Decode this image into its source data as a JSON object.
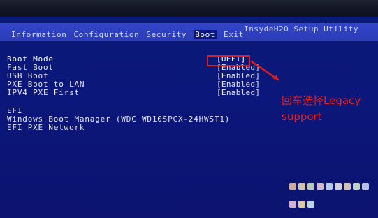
{
  "bios": {
    "utility_title": "InsydeH2O Setup Utility",
    "tabs": [
      {
        "label": "Information"
      },
      {
        "label": "Configuration"
      },
      {
        "label": "Security"
      },
      {
        "label": "Boot",
        "active": true
      },
      {
        "label": "Exit"
      }
    ],
    "settings": [
      {
        "label": "Boot Mode",
        "value": "[UEFI]",
        "highlighted": true
      },
      {
        "label": "Fast Boot",
        "value": "[Enabled]"
      },
      {
        "label": "USB Boot",
        "value": "[Enabled]"
      },
      {
        "label": "PXE Boot to LAN",
        "value": "[Enabled]"
      },
      {
        "label": "IPV4 PXE First",
        "value": "[Enabled]"
      },
      {
        "label": "EFI",
        "value": ""
      },
      {
        "label": "Windows Boot Manager (WDC WD10SPCX-24HWST1)",
        "value": ""
      },
      {
        "label": "EFI PXE Network",
        "value": ""
      }
    ]
  },
  "annotation": {
    "line1": "回车选择Legacy",
    "line2": "support",
    "color": "#e81d1d"
  },
  "watermark": {
    "colors": [
      "#f2c7a8",
      "#f4e2b8",
      "#d8e6c8",
      "#f6d2df",
      "#d7e7ff",
      "#f1f1f1",
      "#f6dfc2",
      "#e2f0d9",
      "#d9dcff",
      "#f3cfe6",
      "#ffe8b0",
      "#dff2ff"
    ]
  }
}
